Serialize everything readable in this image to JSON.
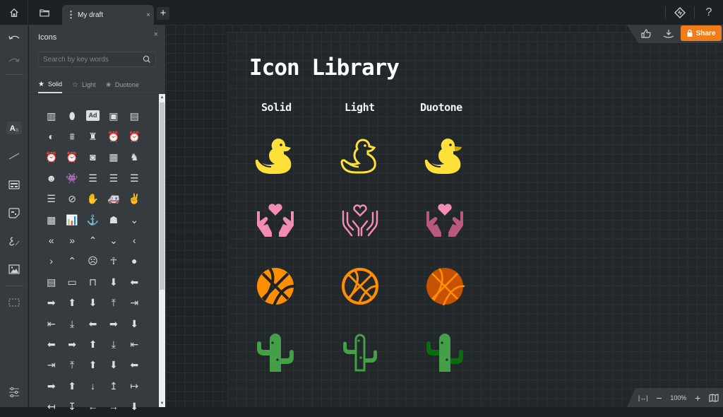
{
  "topbar": {
    "home_icon": "home-icon",
    "folder_icon": "folder-icon",
    "tab": {
      "label": "My draft",
      "menu_icon": "⋮",
      "close": "×"
    },
    "new_tab": "+",
    "right": {
      "feature_icon": "diamond-icon",
      "help": "?"
    }
  },
  "rail": {
    "items": [
      "undo",
      "redo",
      "text",
      "line",
      "template",
      "sticky-note",
      "draw",
      "image",
      "frame",
      "settings"
    ],
    "text_label": "A",
    "text_sub": "a"
  },
  "panel": {
    "title": "Icons",
    "close": "×",
    "search": {
      "placeholder": "Search by key words",
      "value": ""
    },
    "tabs": [
      {
        "label": "Solid",
        "star": "★",
        "active": true
      },
      {
        "label": "Light",
        "star": "☆",
        "active": false
      },
      {
        "label": "Duotone",
        "star": "✬",
        "active": false
      }
    ],
    "icons": [
      "abacus",
      "acorn",
      "ad",
      "address-book",
      "address-card",
      "adjust",
      "air-conditioner",
      "air-freshener",
      "alarm-clock",
      "alarm-exclamation",
      "alarm-plus",
      "alarm-snooze",
      "album",
      "album-collection",
      "alicorn",
      "alien",
      "alien-monster",
      "align-center",
      "align-justify",
      "align-left",
      "align-right",
      "align-slash",
      "allergies",
      "ambulance",
      "american-sign-language",
      "amp-guitar",
      "analytics",
      "anchor",
      "angel",
      "angle-double-down",
      "angle-double-left",
      "angle-double-right",
      "angle-double-up",
      "angle-down",
      "angle-left",
      "angle-right",
      "angle-up",
      "angry",
      "ankh",
      "apple-alt",
      "apple-crate",
      "archive",
      "archway",
      "arrow-alt-circle-down",
      "arrow-alt-circle-left",
      "arrow-alt-circle-right",
      "arrow-alt-circle-up",
      "arrow-alt-down",
      "arrow-alt-from-bottom",
      "arrow-alt-from-left",
      "arrow-alt-from-right",
      "arrow-alt-from-top",
      "arrow-alt-left",
      "arrow-alt-right",
      "arrow-alt-square-down",
      "arrow-alt-square-left",
      "arrow-alt-square-right",
      "arrow-alt-square-up",
      "arrow-alt-to-bottom",
      "arrow-alt-to-left",
      "arrow-alt-to-right",
      "arrow-alt-to-top",
      "arrow-alt-up",
      "arrow-circle-down",
      "arrow-circle-left",
      "arrow-circle-right",
      "arrow-circle-up",
      "arrow-down",
      "arrow-from-bottom",
      "arrow-from-left",
      "arrow-from-right",
      "arrow-from-top",
      "arrow-left",
      "arrow-right",
      "arrow-square-down"
    ],
    "glyphs": [
      "▥",
      "⬮",
      "Ad",
      "▣",
      "▤",
      "◐",
      "⩩",
      "♜",
      "⏰",
      "⏰",
      "⏰",
      "⏰",
      "◙",
      "▦",
      "♞",
      "☻",
      "👾",
      "☰",
      "☰",
      "☰",
      "☰",
      "⊘",
      "✋",
      "🚑",
      "✌",
      "▦",
      "📊",
      "⚓",
      "☗",
      "⌄",
      "«",
      "»",
      "⌃",
      "⌄",
      "‹",
      "›",
      "⌃",
      "☹",
      "☥",
      "●",
      "▤",
      "▭",
      "⊓",
      "⬇",
      "⬅",
      "➡",
      "⬆",
      "⬇",
      "⤒",
      "⇥",
      "⇤",
      "⤓",
      "⬅",
      "➡",
      "⬇",
      "⬅",
      "➡",
      "⬆",
      "⤓",
      "⇤",
      "⇥",
      "⤒",
      "⬆",
      "⬇",
      "⬅",
      "➡",
      "⬆",
      "↓",
      "↥",
      "↦",
      "↤",
      "↧",
      "←",
      "→",
      "⬇"
    ]
  },
  "canvas": {
    "title": "Icon Library",
    "columns": [
      "Solid",
      "Light",
      "Duotone"
    ],
    "rows": [
      "duck",
      "hand-holding-heart",
      "basketball-ball",
      "cactus"
    ],
    "colors": {
      "duck": "#fde138",
      "duck_accent": "#c9a800",
      "heart": "#f28cb1",
      "heart_dark": "#b85a7e",
      "ball": "#ff8f00",
      "ball_dark": "#c65100",
      "cactus": "#43a047",
      "cactus_dark": "#0a6b12"
    }
  },
  "actions": {
    "like_icon": "thumbs-up-icon",
    "download_icon": "download-icon",
    "share_label": "Share",
    "share_color": "#f07d1a"
  },
  "zoom": {
    "fit_label": "|↔|",
    "minus": "−",
    "value": "100%",
    "plus": "+",
    "map_icon": "map-icon"
  }
}
